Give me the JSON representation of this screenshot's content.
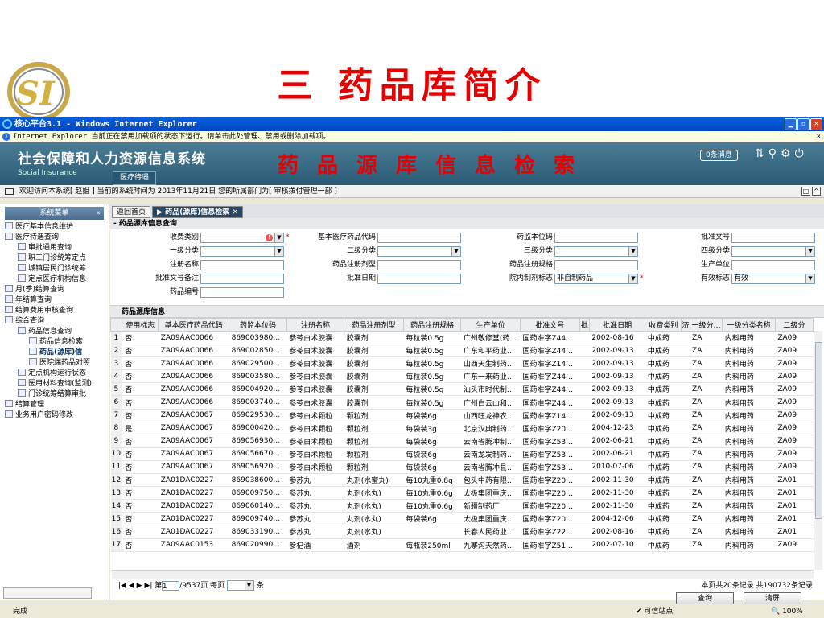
{
  "slide": {
    "title": "三  药品库简介"
  },
  "browser": {
    "title": "核心平台3.1 - Windows Internet Explorer",
    "infobar": "Internet Explorer 当前正在禁用加载项的状态下运行。请单击此处管理、禁用或删除加载项。",
    "infobar_close": "×"
  },
  "app": {
    "system_name": "社会保障和人力资源信息系统",
    "subtitle": "Social Insurance",
    "module_tab": "医疗待遇",
    "headline": "药品源库信息检索",
    "message_badge": "0条消息",
    "welcome": "欢迎访问本系统[ 赵姐 ] 当前的系统时间为 2013年11月21日 您的所属部门为[ 审核拨付管理一部 ]"
  },
  "sidebar": {
    "header": "系统菜单",
    "items": [
      {
        "label": "医疗基本信息维护",
        "level": 1
      },
      {
        "label": "医疗待遇查询",
        "level": 1
      },
      {
        "label": "审批通用查询",
        "level": 2
      },
      {
        "label": "职工门诊统筹定点",
        "level": 2
      },
      {
        "label": "城镇居民门诊统筹",
        "level": 2
      },
      {
        "label": "定点医疗机构信息",
        "level": 2
      },
      {
        "label": "月(季)结算查询",
        "level": 1
      },
      {
        "label": "年结算查询",
        "level": 1
      },
      {
        "label": "结算费用审核查询",
        "level": 1
      },
      {
        "label": "综合查询",
        "level": 1
      },
      {
        "label": "药品信息查询",
        "level": 2
      },
      {
        "label": "药品信息检索",
        "level": 3
      },
      {
        "label": "药品(源库)信",
        "level": 3
      },
      {
        "label": "医院端药品对照",
        "level": 3
      },
      {
        "label": "定点机构运行状态",
        "level": 2
      },
      {
        "label": "医用材料查询(监测)",
        "level": 2
      },
      {
        "label": "门诊统筹结算审批",
        "level": 2
      },
      {
        "label": "结算管理",
        "level": 1
      },
      {
        "label": "业务用户密码修改",
        "level": 1
      }
    ]
  },
  "tabs": {
    "home": "返回首页",
    "active": "药品(源库)信息检索"
  },
  "form": {
    "section_title": "药品源库信息查询",
    "labels": {
      "fee_type": "收费类别",
      "code": "基本医疗药品代码",
      "std_code": "药监本位码",
      "approval_no": "批准文号",
      "cat1": "一级分类",
      "cat2": "二级分类",
      "cat3": "三级分类",
      "cat4": "四级分类",
      "reg_name": "注册名称",
      "dosage": "药品注册剂型",
      "spec": "药品注册规格",
      "manufacturer": "生产单位",
      "approval_note": "批准文号备注",
      "approval_date": "批准日期",
      "hospital_flag": "院内制剂标志",
      "valid_flag": "有效标志",
      "drug_no": "药品编号"
    },
    "values": {
      "hospital_flag": "非自制药品",
      "valid_flag": "有效"
    }
  },
  "table": {
    "section_title": "药品源库信息",
    "columns": [
      "使用标志",
      "基本医疗药品代码",
      "药监本位码",
      "注册名称",
      "药品注册剂型",
      "药品注册规格",
      "生产单位",
      "批准文号",
      "批",
      "批准日期",
      "收费类别",
      "济",
      "一级分…",
      "一级分类名称",
      "二级分"
    ],
    "rows": [
      [
        "1",
        "否",
        "ZA09AAC0066",
        "869003980…",
        "参苓白术胶囊",
        "胶囊剂",
        "每粒装0.5g",
        "广州敬修堂(药…",
        "国药准字Z44…",
        "",
        "2002-08-16",
        "中成药",
        "",
        "ZA",
        "内科用药",
        "ZA09"
      ],
      [
        "2",
        "否",
        "ZA09AAC0066",
        "869002850…",
        "参苓白术胶囊",
        "胶囊剂",
        "每粒装0.5g",
        "广东和平药业…",
        "国药准字Z44…",
        "",
        "2002-09-13",
        "中成药",
        "",
        "ZA",
        "内科用药",
        "ZA09"
      ],
      [
        "3",
        "否",
        "ZA09AAC0066",
        "869029500…",
        "参苓白术胶囊",
        "胶囊剂",
        "每粒装0.5g",
        "山西天生制药…",
        "国药准字Z14…",
        "",
        "2002-09-13",
        "中成药",
        "",
        "ZA",
        "内科用药",
        "ZA09"
      ],
      [
        "4",
        "否",
        "ZA09AAC0066",
        "869003580…",
        "参苓白术胶囊",
        "胶囊剂",
        "每粒装0.5g",
        "广东一来药业…",
        "国药准字Z44…",
        "",
        "2002-09-13",
        "中成药",
        "",
        "ZA",
        "内科用药",
        "ZA09"
      ],
      [
        "5",
        "否",
        "ZA09AAC0066",
        "869004920…",
        "参苓白术胶囊",
        "胶囊剂",
        "每粒装0.5g",
        "汕头市时代制…",
        "国药准字Z44…",
        "",
        "2002-09-13",
        "中成药",
        "",
        "ZA",
        "内科用药",
        "ZA09"
      ],
      [
        "6",
        "否",
        "ZA09AAC0066",
        "869003740…",
        "参苓白术胶囊",
        "胶囊剂",
        "每粒装0.5g",
        "广州白云山和…",
        "国药准字Z44…",
        "",
        "2002-09-13",
        "中成药",
        "",
        "ZA",
        "内科用药",
        "ZA09"
      ],
      [
        "7",
        "否",
        "ZA09AAC0067",
        "869029530…",
        "参苓白术颗粒",
        "颗粒剂",
        "每袋装6g",
        "山西旺龙神农…",
        "国药准字Z14…",
        "",
        "2002-09-13",
        "中成药",
        "",
        "ZA",
        "内科用药",
        "ZA09"
      ],
      [
        "8",
        "是",
        "ZA09AAC0067",
        "869000420…",
        "参苓白术颗粒",
        "颗粒剂",
        "每袋装3g",
        "北京汉典制药…",
        "国药准字Z20…",
        "",
        "2004-12-23",
        "中成药",
        "",
        "ZA",
        "内科用药",
        "ZA09"
      ],
      [
        "9",
        "否",
        "ZA09AAC0067",
        "869056930…",
        "参苓白术颗粒",
        "颗粒剂",
        "每袋装6g",
        "云南省腾冲制…",
        "国药准字Z53…",
        "",
        "2002-06-21",
        "中成药",
        "",
        "ZA",
        "内科用药",
        "ZA09"
      ],
      [
        "10",
        "否",
        "ZA09AAC0067",
        "869056670…",
        "参苓白术颗粒",
        "颗粒剂",
        "每袋装6g",
        "云南龙发制药…",
        "国药准字Z53…",
        "",
        "2002-06-21",
        "中成药",
        "",
        "ZA",
        "内科用药",
        "ZA09"
      ],
      [
        "11",
        "否",
        "ZA09AAC0067",
        "869056920…",
        "参苓白术颗粒",
        "颗粒剂",
        "每袋装6g",
        "云南省腾冲县…",
        "国药准字Z53…",
        "",
        "2010-07-06",
        "中成药",
        "",
        "ZA",
        "内科用药",
        "ZA09"
      ],
      [
        "12",
        "否",
        "ZA01DAC0227",
        "869038600…",
        "参苏丸",
        "丸剂(水蜜丸)",
        "每10丸重0.8g",
        "包头中药有限…",
        "国药准字Z20…",
        "",
        "2002-11-30",
        "中成药",
        "",
        "ZA",
        "内科用药",
        "ZA01"
      ],
      [
        "13",
        "否",
        "ZA01DAC0227",
        "869009750…",
        "参苏丸",
        "丸剂(水丸)",
        "每10丸重0.6g",
        "太极集团重庆…",
        "国药准字Z20…",
        "",
        "2002-11-30",
        "中成药",
        "",
        "ZA",
        "内科用药",
        "ZA01"
      ],
      [
        "14",
        "否",
        "ZA01DAC0227",
        "869060140…",
        "参苏丸",
        "丸剂(水丸)",
        "每10丸重0.6g",
        "新疆制药厂",
        "国药准字Z20…",
        "",
        "2002-11-30",
        "中成药",
        "",
        "ZA",
        "内科用药",
        "ZA01"
      ],
      [
        "15",
        "否",
        "ZA01DAC0227",
        "869009740…",
        "参苏丸",
        "丸剂(水丸)",
        "每袋装6g",
        "太极集团重庆…",
        "国药准字Z20…",
        "",
        "2004-12-06",
        "中成药",
        "",
        "ZA",
        "内科用药",
        "ZA01"
      ],
      [
        "16",
        "否",
        "ZA01DAC0227",
        "869033190…",
        "参苏丸",
        "丸剂(水丸)",
        "",
        "长春人民药业…",
        "国药准字Z22…",
        "",
        "2002-08-16",
        "中成药",
        "",
        "ZA",
        "内科用药",
        "ZA01"
      ],
      [
        "17",
        "否",
        "ZA09AAC0153",
        "869020990…",
        "参杞酒",
        "酒剂",
        "每瓶装250ml",
        "九寨沟天然药…",
        "国药准字Z51…",
        "",
        "2002-07-10",
        "中成药",
        "",
        "ZA",
        "内科用药",
        "ZA09"
      ]
    ]
  },
  "pager": {
    "page_label_pre": "第",
    "page": "1",
    "page_label_post": "/9537页 每页",
    "unit": "条",
    "total": "本页共20条记录 共190732条记录"
  },
  "buttons": {
    "query": "查询",
    "clear": "清屏"
  },
  "statusbar": {
    "left": "完成",
    "trusted": "可信站点",
    "zoom": "100%"
  }
}
